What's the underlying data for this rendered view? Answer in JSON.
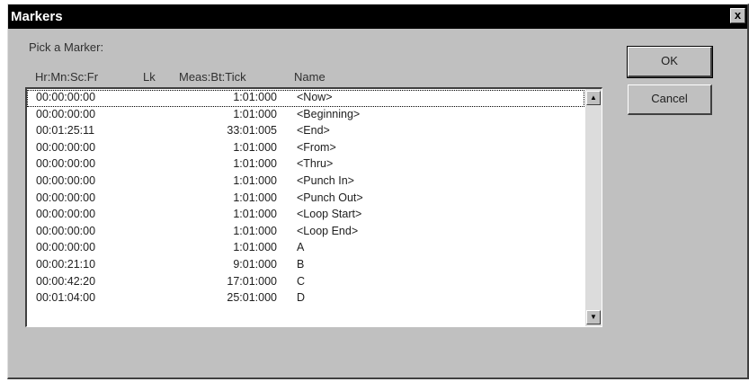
{
  "window": {
    "title": "Markers",
    "close_glyph": "x"
  },
  "pick_label": "Pick a Marker:",
  "columns": [
    "Hr:Mn:Sc:Fr",
    "Lk",
    "Meas:Bt:Tick",
    "Name"
  ],
  "markers": [
    {
      "time": "00:00:00:00",
      "meas": "1:01:000",
      "name": "<Now>"
    },
    {
      "time": "00:00:00:00",
      "meas": "1:01:000",
      "name": "<Beginning>"
    },
    {
      "time": "00:01:25:11",
      "meas": "33:01:005",
      "name": "<End>"
    },
    {
      "time": "00:00:00:00",
      "meas": "1:01:000",
      "name": "<From>"
    },
    {
      "time": "00:00:00:00",
      "meas": "1:01:000",
      "name": "<Thru>"
    },
    {
      "time": "00:00:00:00",
      "meas": "1:01:000",
      "name": "<Punch In>"
    },
    {
      "time": "00:00:00:00",
      "meas": "1:01:000",
      "name": "<Punch Out>"
    },
    {
      "time": "00:00:00:00",
      "meas": "1:01:000",
      "name": "<Loop Start>"
    },
    {
      "time": "00:00:00:00",
      "meas": "1:01:000",
      "name": "<Loop End>"
    },
    {
      "time": "00:00:00:00",
      "meas": "1:01:000",
      "name": "A"
    },
    {
      "time": "00:00:21:10",
      "meas": "9:01:000",
      "name": "B"
    },
    {
      "time": "00:00:42:20",
      "meas": "17:01:000",
      "name": "C"
    },
    {
      "time": "00:01:04:00",
      "meas": "25:01:000",
      "name": "D"
    }
  ],
  "buttons": {
    "ok": "OK",
    "cancel": "Cancel"
  },
  "scrollbar": {
    "up_icon": "scroll-up-arrow",
    "down_icon": "scroll-down-arrow"
  }
}
